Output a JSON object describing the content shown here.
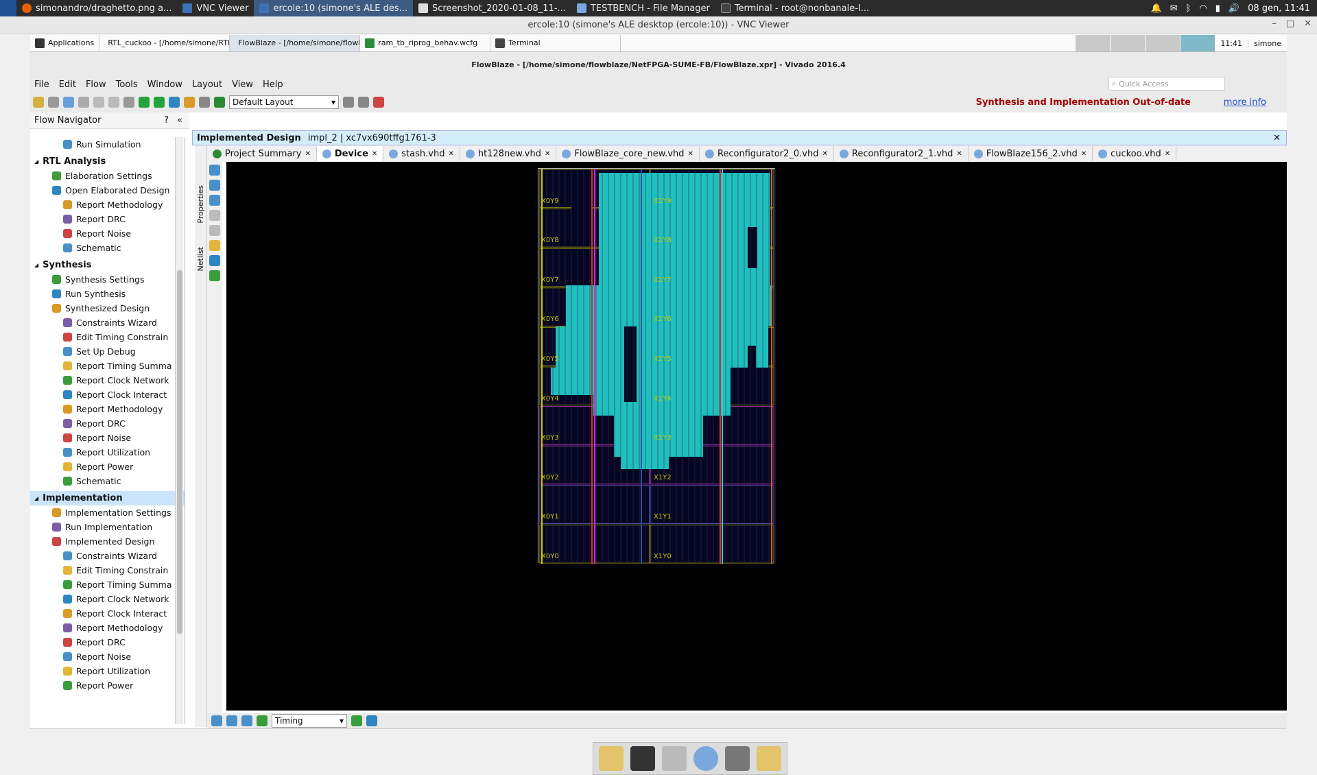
{
  "host": {
    "tasks": [
      {
        "label": "simonandro/draghetto.png a..."
      },
      {
        "label": "VNC Viewer"
      },
      {
        "label": "ercole:10 (simone's ALE des..."
      },
      {
        "label": "Screenshot_2020-01-08_11-..."
      },
      {
        "label": "TESTBENCH - File Manager"
      },
      {
        "label": "Terminal - root@nonbanale-I..."
      }
    ],
    "clock": "08 gen, 11:41"
  },
  "vnc": {
    "title": "ercole:10 (simone's ALE desktop (ercole:10)) - VNC Viewer"
  },
  "guest": {
    "tasks": [
      {
        "label": "Applications"
      },
      {
        "label": "RTL_cuckoo - [/home/simone/RTL..."
      },
      {
        "label": "FlowBlaze - [/home/simone/flowbl..."
      },
      {
        "label": "ram_tb_riprog_behav.wcfg"
      },
      {
        "label": "Terminal"
      }
    ],
    "time": "11:41",
    "user": "simone"
  },
  "vivado": {
    "title": "FlowBlaze - [/home/simone/flowblaze/NetFPGA-SUME-FB/FlowBlaze.xpr] - Vivado 2016.4",
    "quick_access_placeholder": "Quick Access",
    "menu": [
      "File",
      "Edit",
      "Flow",
      "Tools",
      "Window",
      "Layout",
      "View",
      "Help"
    ],
    "layout_select": "Default Layout",
    "out_of_date": "Synthesis and Implementation Out-of-date",
    "more_info": "more info"
  },
  "flow_nav": {
    "title": "Flow Navigator",
    "items": [
      {
        "label": "Run Simulation",
        "cls": "sub2"
      },
      {
        "label": "RTL Analysis",
        "cls": "sec"
      },
      {
        "label": "Elaboration Settings",
        "cls": "sub"
      },
      {
        "label": "Open Elaborated Design",
        "cls": "sub"
      },
      {
        "label": "Report Methodology",
        "cls": "sub2"
      },
      {
        "label": "Report DRC",
        "cls": "sub2"
      },
      {
        "label": "Report Noise",
        "cls": "sub2"
      },
      {
        "label": "Schematic",
        "cls": "sub2"
      },
      {
        "label": "Synthesis",
        "cls": "sec"
      },
      {
        "label": "Synthesis Settings",
        "cls": "sub"
      },
      {
        "label": "Run Synthesis",
        "cls": "sub"
      },
      {
        "label": "Synthesized Design",
        "cls": "sub"
      },
      {
        "label": "Constraints Wizard",
        "cls": "sub2"
      },
      {
        "label": "Edit Timing Constrain",
        "cls": "sub2"
      },
      {
        "label": "Set Up Debug",
        "cls": "sub2"
      },
      {
        "label": "Report Timing Summa",
        "cls": "sub2"
      },
      {
        "label": "Report Clock Network",
        "cls": "sub2"
      },
      {
        "label": "Report Clock Interact",
        "cls": "sub2"
      },
      {
        "label": "Report Methodology",
        "cls": "sub2"
      },
      {
        "label": "Report DRC",
        "cls": "sub2"
      },
      {
        "label": "Report Noise",
        "cls": "sub2"
      },
      {
        "label": "Report Utilization",
        "cls": "sub2"
      },
      {
        "label": "Report Power",
        "cls": "sub2"
      },
      {
        "label": "Schematic",
        "cls": "sub2"
      },
      {
        "label": "Implementation",
        "cls": "sec impl"
      },
      {
        "label": "Implementation Settings",
        "cls": "sub"
      },
      {
        "label": "Run Implementation",
        "cls": "sub"
      },
      {
        "label": "Implemented Design",
        "cls": "sub"
      },
      {
        "label": "Constraints Wizard",
        "cls": "sub2"
      },
      {
        "label": "Edit Timing Constrain",
        "cls": "sub2"
      },
      {
        "label": "Report Timing Summa",
        "cls": "sub2"
      },
      {
        "label": "Report Clock Network",
        "cls": "sub2"
      },
      {
        "label": "Report Clock Interact",
        "cls": "sub2"
      },
      {
        "label": "Report Methodology",
        "cls": "sub2"
      },
      {
        "label": "Report DRC",
        "cls": "sub2"
      },
      {
        "label": "Report Noise",
        "cls": "sub2"
      },
      {
        "label": "Report Utilization",
        "cls": "sub2"
      },
      {
        "label": "Report Power",
        "cls": "sub2"
      }
    ]
  },
  "side_tabs": [
    "Properties",
    "Netlist"
  ],
  "impl_header": {
    "title": "Implemented Design",
    "subtitle": "impl_2 | xc7vx690tffg1761-3"
  },
  "tabs": [
    {
      "label": "Project Summary"
    },
    {
      "label": "Device"
    },
    {
      "label": "stash.vhd"
    },
    {
      "label": "ht128new.vhd"
    },
    {
      "label": "FlowBlaze_core_new.vhd"
    },
    {
      "label": "Reconfigurator2_0.vhd"
    },
    {
      "label": "Reconfigurator2_1.vhd"
    },
    {
      "label": "FlowBlaze156_2.vhd"
    },
    {
      "label": "cuckoo.vhd"
    }
  ],
  "device": {
    "clock_regions_left": [
      "X0Y9",
      "X0Y8",
      "X0Y7",
      "X0Y6",
      "X0Y5",
      "X0Y4",
      "X0Y3",
      "X0Y2",
      "X0Y1",
      "X0Y0"
    ],
    "clock_regions_right": [
      "X1Y9",
      "X1Y8",
      "X1Y7",
      "X1Y6",
      "X1Y5",
      "X1Y4",
      "X1Y3",
      "X1Y2",
      "X1Y1",
      "X1Y0"
    ]
  },
  "bottom": {
    "timing_select": "Timing"
  },
  "colors": {
    "accent": "#1fbfbf",
    "warn": "#a30000",
    "link": "#1a4fcf",
    "impl_bg": "#d4eef9"
  }
}
